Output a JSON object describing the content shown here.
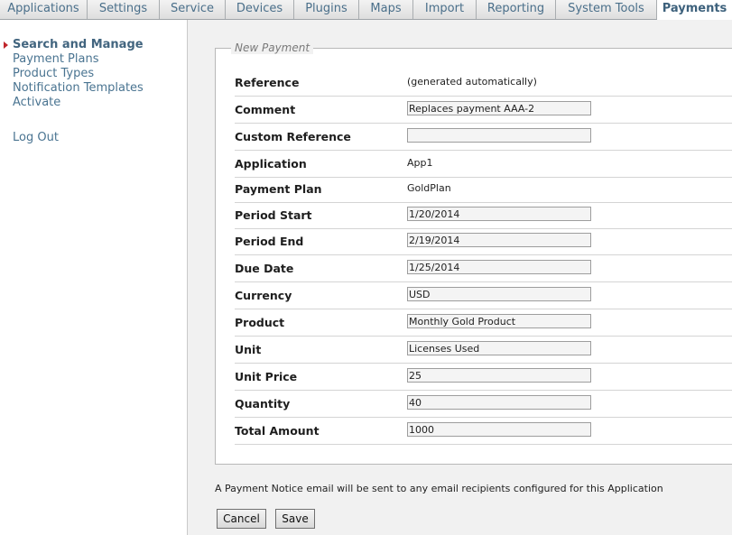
{
  "tabs": [
    {
      "label": "Applications"
    },
    {
      "label": "Settings"
    },
    {
      "label": "Service"
    },
    {
      "label": "Devices"
    },
    {
      "label": "Plugins"
    },
    {
      "label": "Maps"
    },
    {
      "label": "Import"
    },
    {
      "label": "Reporting"
    },
    {
      "label": "System Tools"
    },
    {
      "label": "Payments",
      "active": true
    }
  ],
  "sidebar": {
    "items": [
      {
        "label": "Search and Manage",
        "current": true
      },
      {
        "label": "Payment Plans"
      },
      {
        "label": "Product Types"
      },
      {
        "label": "Notification Templates"
      },
      {
        "label": "Activate"
      }
    ],
    "logout_label": "Log Out"
  },
  "form": {
    "legend": "New Payment",
    "fields": [
      {
        "label": "Reference",
        "type": "text",
        "value": "(generated automatically)"
      },
      {
        "label": "Comment",
        "type": "input",
        "value": "Replaces payment AAA-2"
      },
      {
        "label": "Custom Reference",
        "type": "input",
        "value": ""
      },
      {
        "label": "Application",
        "type": "text",
        "value": "App1"
      },
      {
        "label": "Payment Plan",
        "type": "text",
        "value": "GoldPlan"
      },
      {
        "label": "Period Start",
        "type": "input",
        "value": "1/20/2014"
      },
      {
        "label": "Period End",
        "type": "input",
        "value": "2/19/2014"
      },
      {
        "label": "Due Date",
        "type": "input",
        "value": "1/25/2014"
      },
      {
        "label": "Currency",
        "type": "input",
        "value": "USD"
      },
      {
        "label": "Product",
        "type": "input",
        "value": "Monthly Gold Product"
      },
      {
        "label": "Unit",
        "type": "input",
        "value": "Licenses Used"
      },
      {
        "label": "Unit Price",
        "type": "input",
        "value": "25"
      },
      {
        "label": "Quantity",
        "type": "input",
        "value": "40"
      },
      {
        "label": "Total Amount",
        "type": "input",
        "value": "1000"
      }
    ]
  },
  "notice": "A Payment Notice email will be sent to any email recipients configured for this Application",
  "buttons": {
    "cancel_label": "Cancel",
    "save_label": "Save"
  },
  "colors": {
    "link": "#4a7491",
    "active_marker": "#c0262b",
    "content_bg": "#f1f1f1"
  }
}
